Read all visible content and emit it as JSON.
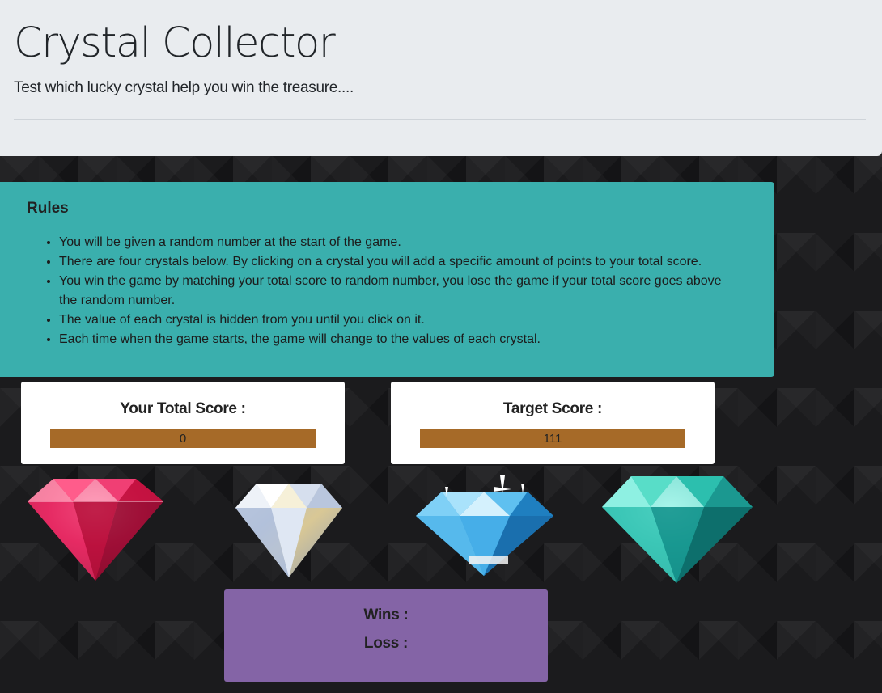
{
  "header": {
    "title": "Crystal Collector",
    "subtitle": "Test which lucky crystal help you win the treasure...."
  },
  "rules": {
    "heading": "Rules",
    "items": [
      "You will be given a random number at the start of the game.",
      "There are four crystals below. By clicking on a crystal you will add a specific amount of points to your total score.",
      "You win the game by matching your total score to random number, you lose the game if your total score goes above the random number.",
      "The value of each crystal is hidden from you until you click on it.",
      "Each time when the game starts, the game will change to the values of each crystal."
    ]
  },
  "scores": {
    "total_label": "Your Total Score :",
    "total_value": "0",
    "target_label": "Target Score :",
    "target_value": "111"
  },
  "crystals": [
    {
      "name": "red-crystal",
      "color": "#d81b52"
    },
    {
      "name": "clear-crystal",
      "color": "#e8ecf2"
    },
    {
      "name": "blue-crystal",
      "color": "#3aa3e0"
    },
    {
      "name": "teal-crystal",
      "color": "#29b8ac"
    }
  ],
  "record": {
    "wins_label": "Wins :",
    "losses_label": "Loss :"
  },
  "colors": {
    "header_bg": "#e9ecef",
    "rules_bg": "#3aafad",
    "score_bar": "#a66a28",
    "record_bg": "#8464a6"
  }
}
